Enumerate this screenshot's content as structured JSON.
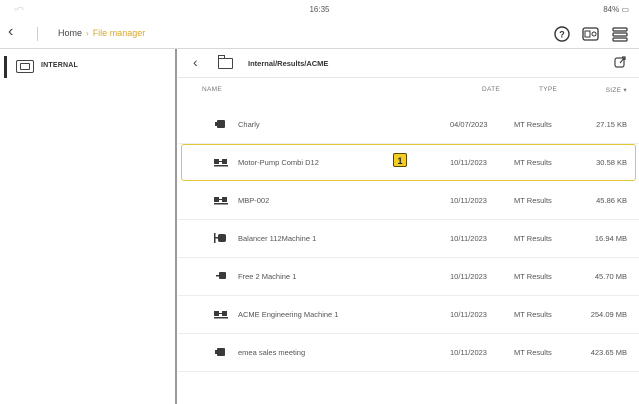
{
  "status": {
    "wifi": "wifi",
    "time": "16:35",
    "battery": "84%"
  },
  "nav": {
    "back_icon": "chevron-left-icon",
    "breadcrumb": {
      "home": "Home",
      "separator": "›",
      "current": "File manager"
    },
    "icons": [
      "help-icon",
      "device-icon",
      "menu-icon"
    ]
  },
  "sidebar": {
    "items": [
      {
        "label": "INTERNAL",
        "icon": "drive-icon"
      }
    ]
  },
  "path": {
    "text": "Internal/Results/ACME"
  },
  "table": {
    "headers": {
      "name": "NAME",
      "date": "DATE",
      "type": "TYPE",
      "size": "SIZE ▾"
    },
    "rows": [
      {
        "icon": "machine-single-icon",
        "name": "Charly",
        "date": "04/07/2023",
        "type": "MT Results",
        "size": "27.15 KB"
      },
      {
        "icon": "motor-pump-icon",
        "name": "Motor-Pump Combi D12",
        "date": "10/11/2023",
        "type": "MT Results",
        "size": "30.58 KB"
      },
      {
        "icon": "motor-pump-icon",
        "name": "MBP-002",
        "date": "10/11/2023",
        "type": "MT Results",
        "size": "45.86 KB"
      },
      {
        "icon": "balancer-icon",
        "name": "Balancer 112Machine 1",
        "date": "10/11/2023",
        "type": "MT Results",
        "size": "16.94 MB"
      },
      {
        "icon": "machine-small-icon",
        "name": "Free 2 Machine 1",
        "date": "10/11/2023",
        "type": "MT Results",
        "size": "45.70 MB"
      },
      {
        "icon": "motor-pump-icon",
        "name": "ACME Engineering Machine 1",
        "date": "10/11/2023",
        "type": "MT Results",
        "size": "254.09 MB"
      },
      {
        "icon": "machine-single-icon",
        "name": "emea sales meeting",
        "date": "10/11/2023",
        "type": "MT Results",
        "size": "423.65 MB"
      }
    ]
  },
  "annotation": {
    "badge": "1"
  },
  "colors": {
    "accent": "#d9a82a",
    "highlight": "#e2c63a",
    "badge": "#f3cd25"
  }
}
